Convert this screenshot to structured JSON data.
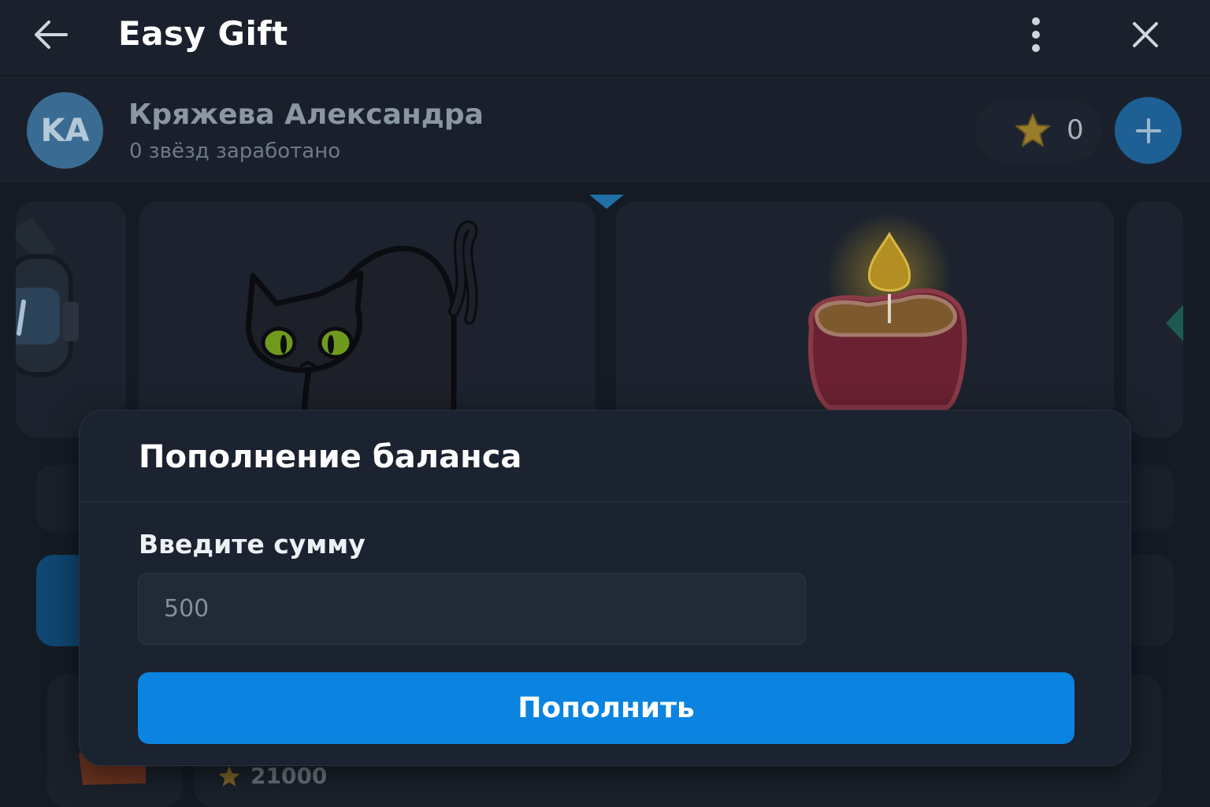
{
  "header": {
    "title": "Easy Gift",
    "icons": {
      "back": "arrow-left-icon",
      "more": "more-vertical-icon",
      "close": "close-icon"
    }
  },
  "user": {
    "initials": "KA",
    "name": "Кряжева Александра",
    "stars_earned": "0 звёзд заработано",
    "balance": "0",
    "add_icon": "plus-icon"
  },
  "gifts": {
    "items": [
      {
        "icon": "helmet-icon"
      },
      {
        "icon": "black-cat-icon"
      },
      {
        "icon": "heart-candle-icon"
      },
      {
        "icon": "gem-icon"
      }
    ],
    "bottom_price": "21000"
  },
  "modal": {
    "title": "Пополнение баланса",
    "label": "Введите сумму",
    "amount_placeholder": "500",
    "submit_label": "Пополнить"
  },
  "colors": {
    "accent": "#0a84e0",
    "modal_bg": "#1b2230",
    "page_bg": "#151b25",
    "star": "#c9a227"
  }
}
